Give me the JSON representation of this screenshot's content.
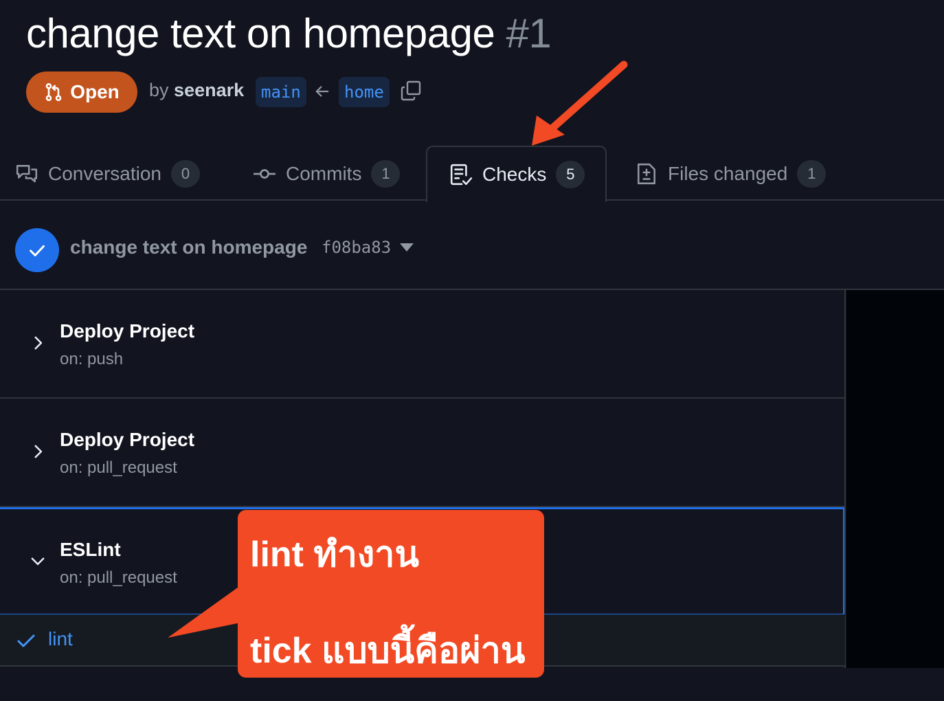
{
  "pr": {
    "title": "change text on homepage",
    "number": "#1",
    "state": "Open",
    "by_prefix": "by",
    "author": "seenark",
    "base_branch": "main",
    "head_branch": "home"
  },
  "tabs": [
    {
      "label": "Conversation",
      "count": "0",
      "icon": "comment-discussion-icon"
    },
    {
      "label": "Commits",
      "count": "1",
      "icon": "git-commit-icon"
    },
    {
      "label": "Checks",
      "count": "5",
      "icon": "checklist-icon",
      "active": true
    },
    {
      "label": "Files changed",
      "count": "1",
      "icon": "file-diff-icon"
    }
  ],
  "commit": {
    "message": "change text on homepage",
    "sha": "f08ba83",
    "status": "success"
  },
  "workflows": [
    {
      "name": "Deploy Project",
      "event": "on: push",
      "expanded": false
    },
    {
      "name": "Deploy Project",
      "event": "on: pull_request",
      "expanded": false
    },
    {
      "name": "ESLint",
      "event": "on: pull_request",
      "expanded": true
    }
  ],
  "jobs": [
    {
      "name": "lint",
      "status": "success"
    }
  ],
  "annotation": {
    "line1": "lint ทำงาน",
    "line2": "tick แบบนี้คือผ่าน",
    "color": "#f24a24"
  },
  "colors": {
    "background": "#12141f",
    "open_badge": "#c4541d",
    "accent_blue": "#1f6feb",
    "link_blue": "#4493f8"
  }
}
